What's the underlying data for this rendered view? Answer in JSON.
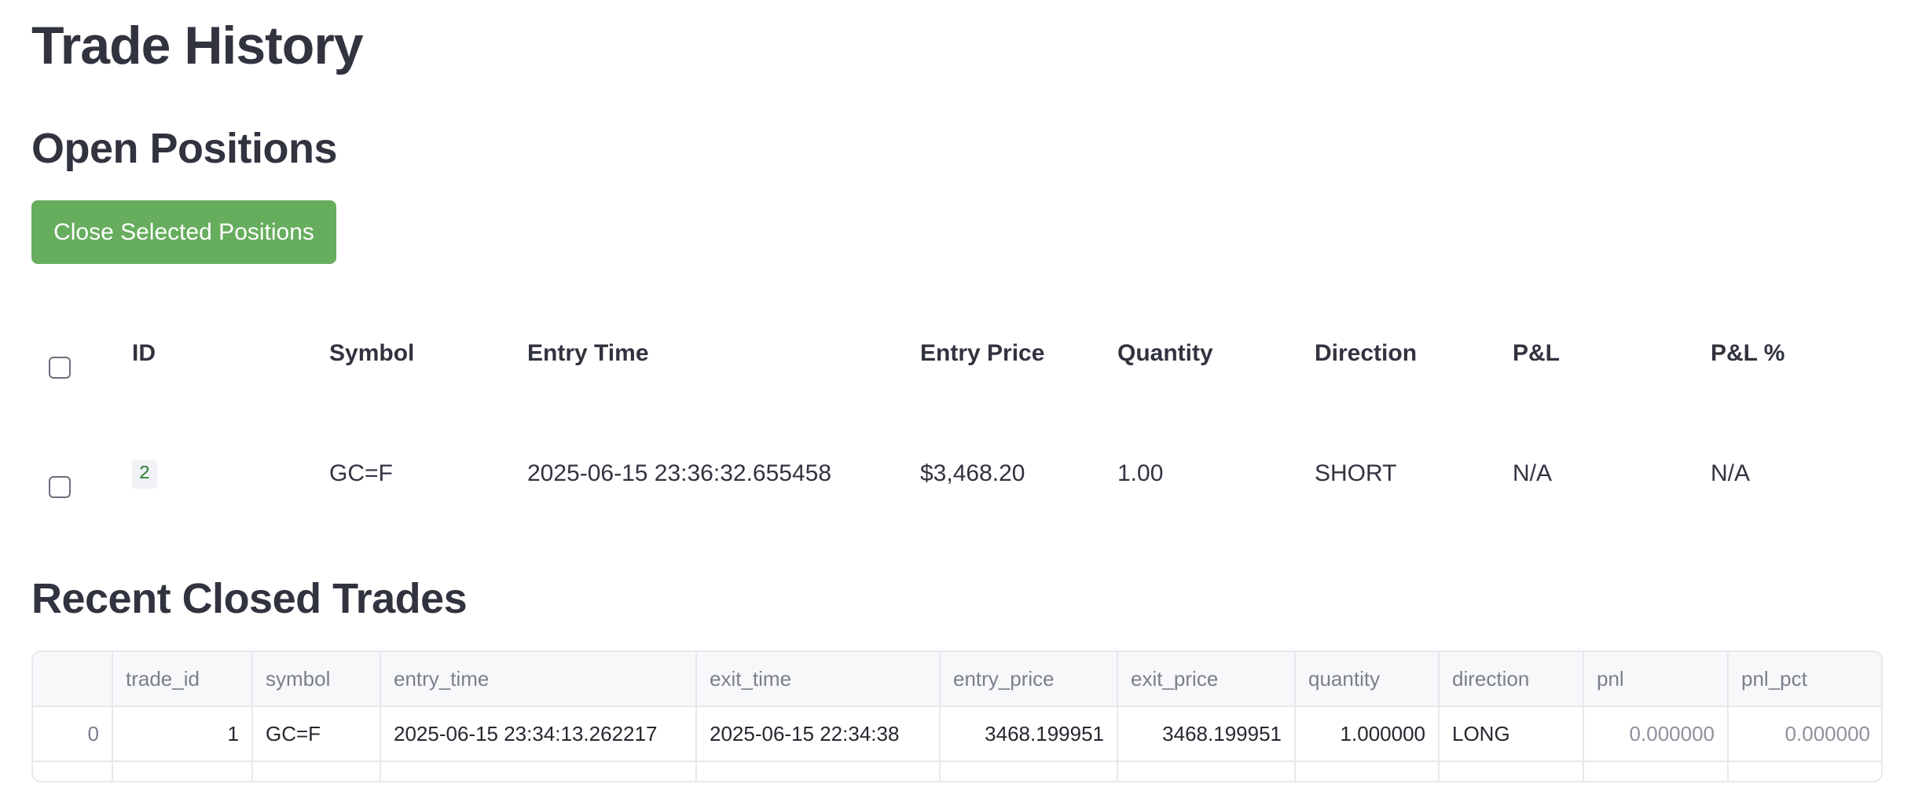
{
  "page": {
    "title": "Trade History"
  },
  "open_positions": {
    "heading": "Open Positions",
    "close_button_label": "Close Selected Positions",
    "headers": {
      "id": "ID",
      "symbol": "Symbol",
      "entry_time": "Entry Time",
      "entry_price": "Entry Price",
      "quantity": "Quantity",
      "direction": "Direction",
      "pnl": "P&L",
      "pnl_pct": "P&L %"
    },
    "rows": [
      {
        "checked": false,
        "id": "2",
        "symbol": "GC=F",
        "entry_time": "2025-06-15 23:36:32.655458",
        "entry_price": "$3,468.20",
        "quantity": "1.00",
        "direction": "SHORT",
        "pnl": "N/A",
        "pnl_pct": "N/A"
      }
    ]
  },
  "closed_trades": {
    "heading": "Recent Closed Trades",
    "columns": [
      "",
      "trade_id",
      "symbol",
      "entry_time",
      "exit_time",
      "entry_price",
      "exit_price",
      "quantity",
      "direction",
      "pnl",
      "pnl_pct"
    ],
    "rows": [
      {
        "index": "0",
        "trade_id": "1",
        "symbol": "GC=F",
        "entry_time": "2025-06-15 23:34:13.262217",
        "exit_time": "2025-06-15 22:34:38",
        "entry_price": "3468.199951",
        "exit_price": "3468.199951",
        "quantity": "1.000000",
        "direction": "LONG",
        "pnl": "0.000000",
        "pnl_pct": "0.000000"
      }
    ]
  },
  "colors": {
    "button_bg": "#66ad5e",
    "text": "#31333f",
    "id_badge_text": "#2e7d32"
  }
}
